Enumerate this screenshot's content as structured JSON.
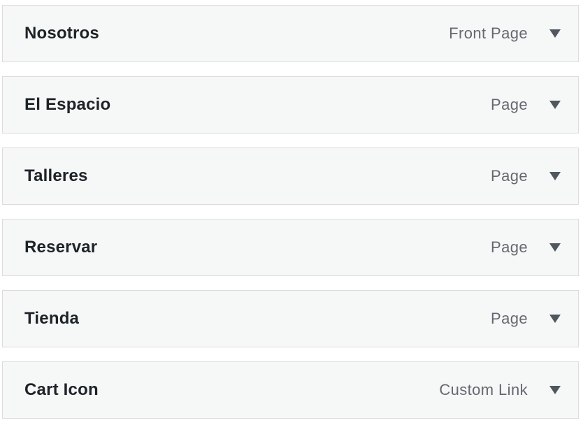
{
  "menu_items": [
    {
      "title": "Nosotros",
      "type": "Front Page",
      "toggle_icon": "triangle-down-icon"
    },
    {
      "title": "El Espacio",
      "type": "Page",
      "toggle_icon": "triangle-down-icon"
    },
    {
      "title": "Talleres",
      "type": "Page",
      "toggle_icon": "triangle-down-icon"
    },
    {
      "title": "Reservar",
      "type": "Page",
      "toggle_icon": "triangle-down-icon"
    },
    {
      "title": "Tienda",
      "type": "Page",
      "toggle_icon": "triangle-down-icon"
    },
    {
      "title": "Cart Icon",
      "type": "Custom Link",
      "toggle_icon": "triangle-down-icon"
    }
  ],
  "colors": {
    "item_background": "#f6f7f7",
    "item_border": "#dcdcde",
    "title_text": "#1d2327",
    "type_text": "#646970",
    "arrow": "#50575e"
  }
}
